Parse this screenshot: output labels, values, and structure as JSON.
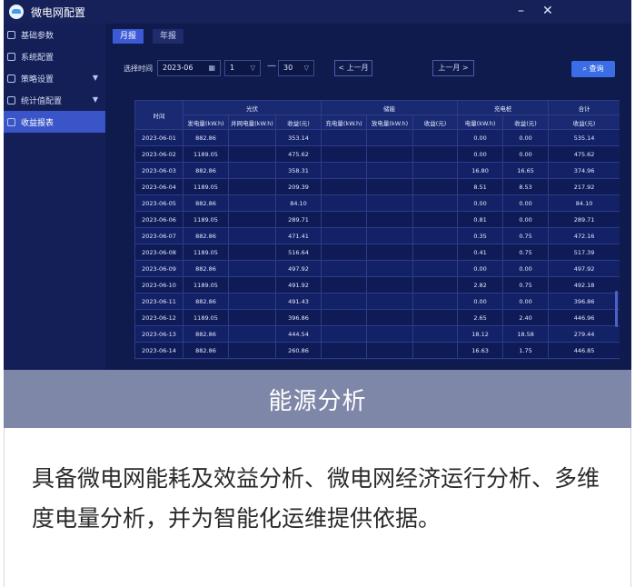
{
  "window": {
    "title": "微电网配置",
    "minimize": "–",
    "close": "✕"
  },
  "sidebar": {
    "items": [
      {
        "label": "基础参数",
        "icon": "gear-icon",
        "has_chevron": false
      },
      {
        "label": "系统配置",
        "icon": "grid-icon",
        "has_chevron": false
      },
      {
        "label": "策略设置",
        "icon": "strategy-icon",
        "has_chevron": true
      },
      {
        "label": "统计值配置",
        "icon": "stats-icon",
        "has_chevron": true
      },
      {
        "label": "收益报表",
        "icon": "report-icon",
        "has_chevron": false,
        "active": true
      }
    ]
  },
  "tabs": [
    {
      "label": "月报",
      "active": true
    },
    {
      "label": "年报",
      "active": false
    }
  ],
  "toolbar": {
    "select_time_label": "选择时间",
    "month_value": "2023-06",
    "day_start": "1",
    "dash": "—",
    "day_end": "30",
    "prev_month": "< 上一月",
    "next_month": "上一月 >",
    "query": "查询"
  },
  "table": {
    "group_headers": [
      "时间",
      "光伏",
      "储能",
      "充电桩",
      "合计"
    ],
    "sub_headers": [
      "发电量(kW.h)",
      "并网电量(kW.h)",
      "收益(元)",
      "充电量(kW.h)",
      "放电量(kW.h)",
      "收益(元)",
      "电量(kW.h)",
      "收益(元)",
      "收益(元)"
    ],
    "rows": [
      [
        "2023-06-01",
        "882.86",
        "",
        "353.14",
        "",
        "",
        "",
        "0.00",
        "0.00",
        "535.14"
      ],
      [
        "2023-06-02",
        "1189.05",
        "",
        "475.62",
        "",
        "",
        "",
        "0.00",
        "0.00",
        "475.62"
      ],
      [
        "2023-06-03",
        "882.86",
        "",
        "358.31",
        "",
        "",
        "",
        "16.80",
        "16.65",
        "374.96"
      ],
      [
        "2023-06-04",
        "1189.05",
        "",
        "209.39",
        "",
        "",
        "",
        "8.51",
        "8.53",
        "217.92"
      ],
      [
        "2023-06-05",
        "882.86",
        "",
        "84.10",
        "",
        "",
        "",
        "0.00",
        "0.00",
        "84.10"
      ],
      [
        "2023-06-06",
        "1189.05",
        "",
        "289.71",
        "",
        "",
        "",
        "0.81",
        "0.00",
        "289.71"
      ],
      [
        "2023-06-07",
        "882.86",
        "",
        "471.41",
        "",
        "",
        "",
        "0.35",
        "0.75",
        "472.16"
      ],
      [
        "2023-06-08",
        "1189.05",
        "",
        "516.64",
        "",
        "",
        "",
        "0.41",
        "0.75",
        "517.39"
      ],
      [
        "2023-06-09",
        "882.86",
        "",
        "497.92",
        "",
        "",
        "",
        "0.00",
        "0.00",
        "497.92"
      ],
      [
        "2023-06-10",
        "1189.05",
        "",
        "491.92",
        "",
        "",
        "",
        "2.82",
        "0.75",
        "492.18"
      ],
      [
        "2023-06-11",
        "882.86",
        "",
        "491.43",
        "",
        "",
        "",
        "0.00",
        "0.00",
        "396.86"
      ],
      [
        "2023-06-12",
        "1189.05",
        "",
        "396.86",
        "",
        "",
        "",
        "2.65",
        "2.40",
        "446.96"
      ],
      [
        "2023-06-13",
        "882.86",
        "",
        "444.54",
        "",
        "",
        "",
        "18.12",
        "18.58",
        "279.44"
      ],
      [
        "2023-06-14",
        "882.86",
        "",
        "260.86",
        "",
        "",
        "",
        "16.63",
        "1.75",
        "446.85"
      ]
    ]
  },
  "banner": {
    "title": "能源分析"
  },
  "description": {
    "text": "具备微电网能耗及效益分析、微电网经济运行分析、多维度电量分析，并为智能化运维提供依据。"
  },
  "colors": {
    "app_bg": "#101a4e",
    "sidebar_active": "#3a55c8",
    "query_button": "#3b6ee6",
    "banner_bg": "#7f87a9"
  }
}
